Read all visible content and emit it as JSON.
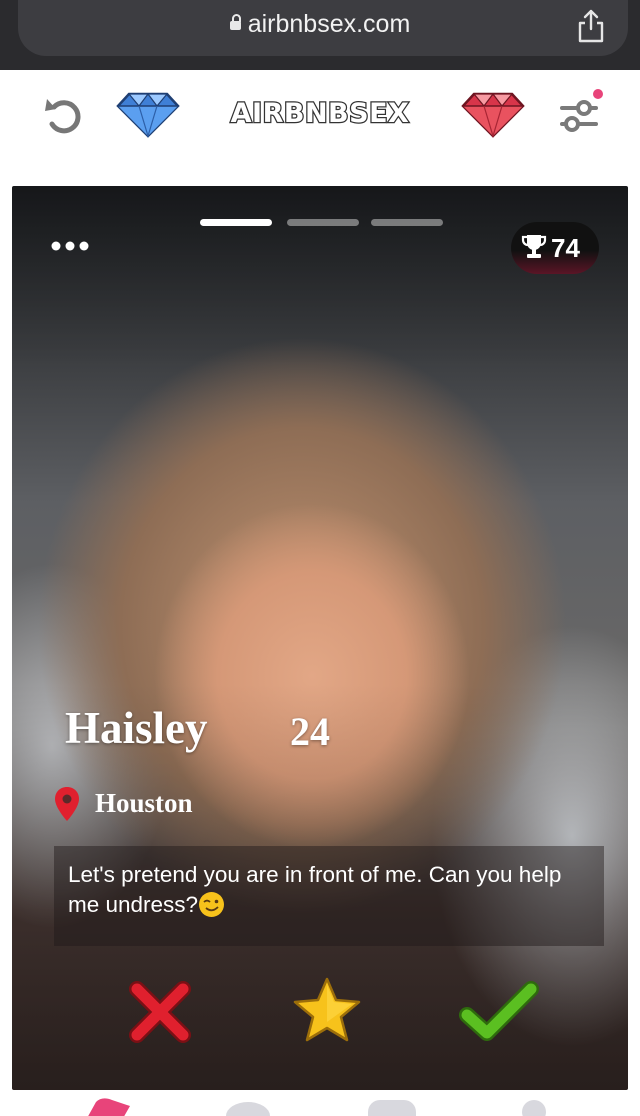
{
  "browser": {
    "url": "airbnbsex.com"
  },
  "header": {
    "brand": "AIRBNBSEX"
  },
  "card": {
    "photo_count": 3,
    "active_photo": 1,
    "score": "74",
    "name": "Haisley",
    "age": "24",
    "location": "Houston",
    "bio": "Let's pretend you are in front of me. Can you help me undress?"
  },
  "icons": {
    "undo": "undo-icon",
    "gem_left": "blue-diamond-icon",
    "gem_right": "red-diamond-icon",
    "filters": "sliders-filter-icon",
    "more": "more-dots-icon",
    "score": "trophy-icon",
    "location": "map-pin-icon",
    "bio_emoji": "winking-face-icon",
    "dislike": "red-x-icon",
    "superlike": "gold-star-icon",
    "like": "green-check-icon"
  },
  "colors": {
    "accent_pink": "#e8447a",
    "dislike_red": "#e0202e",
    "star_gold": "#f7c21b",
    "like_green": "#5bbf21",
    "gem_blue": "#4a90e2",
    "gem_red": "#e2485a"
  }
}
